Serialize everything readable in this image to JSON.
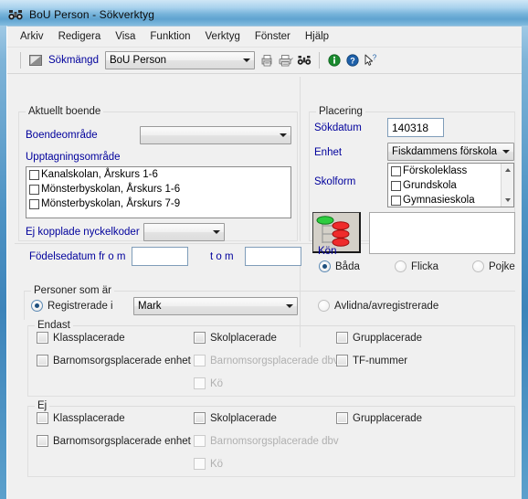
{
  "window": {
    "title": "BoU Person - Sökverktyg",
    "title_icon": "binoculars-icon",
    "frame_color": "#4e93c4",
    "client_bg": "#f0f0f0",
    "label_color": "#00009c"
  },
  "menubar": {
    "items": [
      {
        "label": "Arkiv"
      },
      {
        "label": "Redigera"
      },
      {
        "label": "Visa"
      },
      {
        "label": "Funktion"
      },
      {
        "label": "Verktyg"
      },
      {
        "label": "Fönster"
      },
      {
        "label": "Hjälp"
      }
    ]
  },
  "toolbar": {
    "window_button_icon": "window-restore-icon",
    "sokmangd_label": "Sökmängd",
    "sokmangd_combo": {
      "value": "BoU Person",
      "options": [
        "BoU Person"
      ]
    },
    "buttons": [
      {
        "name": "print-preview-icon",
        "title": "Förhandsgranska"
      },
      {
        "name": "print-icon",
        "title": "Skriv ut"
      },
      {
        "name": "binoculars-search-icon",
        "title": "Sök"
      },
      {
        "name": "info-icon",
        "title": "Information"
      },
      {
        "name": "help-icon",
        "title": "Hjälp"
      },
      {
        "name": "context-help-icon",
        "title": "Direkthjälp"
      }
    ]
  },
  "aktuellt_boende": {
    "title": "Aktuellt boende",
    "boendeomrade_label": "Boendeområde",
    "boendeomrade_value": "",
    "upptagningsomrade_label": "Upptagningsområde",
    "upptagningsomrade_items": [
      {
        "label": "Kanalskolan, Årskurs 1-6",
        "checked": false
      },
      {
        "label": "Mönsterbyskolan, Årskurs 1-6",
        "checked": false
      },
      {
        "label": "Mönsterbyskolan, Årskurs 7-9",
        "checked": false
      }
    ],
    "nyckelkoder_label": "Ej kopplade nyckelkoder",
    "nyckelkoder_value": ""
  },
  "placering": {
    "title": "Placering",
    "sokdatum_label": "Sökdatum",
    "sokdatum_value": "140318",
    "enhet_label": "Enhet",
    "enhet_value": "Fiskdammens förskola",
    "skolform_label": "Skolform",
    "skolform_items": [
      {
        "label": "Förskoleklass",
        "checked": false
      },
      {
        "label": "Grundskola",
        "checked": false
      },
      {
        "label": "Gymnasieskola",
        "checked": false
      }
    ],
    "tree_button_icon": "hierarchy-tree-icon",
    "selection_box_value": ""
  },
  "fodelsedatum": {
    "from_label": "Födelsedatum fr o m",
    "from_value": "",
    "to_label": "t o m",
    "to_value": ""
  },
  "kon": {
    "title": "Kön",
    "options": [
      {
        "label": "Båda",
        "selected": true,
        "enabled": true
      },
      {
        "label": "Flicka",
        "selected": false,
        "enabled": false
      },
      {
        "label": "Pojke",
        "selected": false,
        "enabled": false
      }
    ]
  },
  "personer_som_ar": {
    "title": "Personer som är",
    "registrerade_label": "Registrerade i",
    "registrerade_selected": true,
    "kommun_value": "Mark",
    "avlidna_label": "Avlidna/avregistrerade",
    "avlidna_selected": false
  },
  "endast": {
    "title": "Endast",
    "column1": [
      {
        "label": "Klassplacerade",
        "checked": false,
        "enabled": true
      },
      {
        "label": "Barnomsorgsplacerade enhet",
        "checked": false,
        "enabled": true
      }
    ],
    "column2": [
      {
        "label": "Skolplacerade",
        "checked": false,
        "enabled": true
      },
      {
        "label": "Barnomsorgsplacerade dbv",
        "checked": false,
        "enabled": false
      },
      {
        "label": "Kö",
        "checked": false,
        "enabled": false
      }
    ],
    "column3": [
      {
        "label": "Grupplacerade",
        "checked": false,
        "enabled": true
      },
      {
        "label": "TF-nummer",
        "checked": false,
        "enabled": true
      }
    ]
  },
  "ej": {
    "title": "Ej",
    "column1": [
      {
        "label": "Klassplacerade",
        "checked": false,
        "enabled": true
      },
      {
        "label": "Barnomsorgsplacerade enhet",
        "checked": false,
        "enabled": true
      }
    ],
    "column2": [
      {
        "label": "Skolplacerade",
        "checked": false,
        "enabled": true
      },
      {
        "label": "Barnomsorgsplacerade dbv",
        "checked": false,
        "enabled": false
      },
      {
        "label": "Kö",
        "checked": false,
        "enabled": false
      }
    ],
    "column3": [
      {
        "label": "Grupplacerade",
        "checked": false,
        "enabled": true
      }
    ]
  }
}
